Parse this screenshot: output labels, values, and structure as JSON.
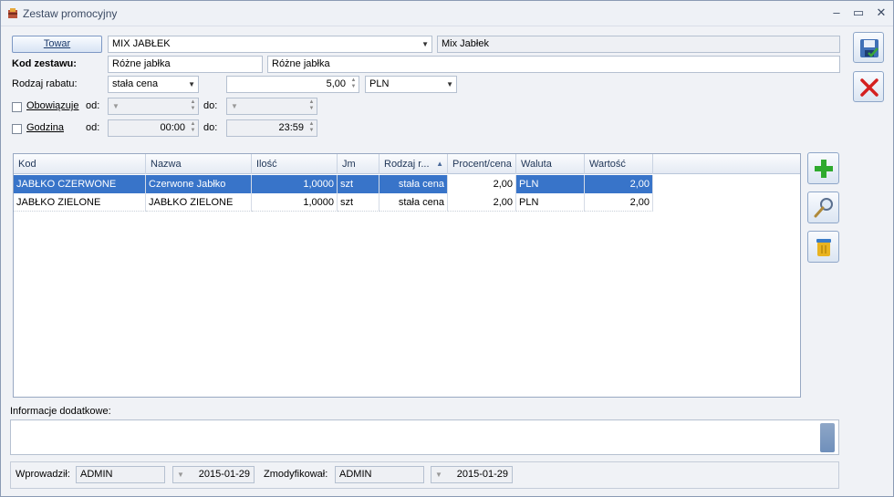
{
  "window": {
    "title": "Zestaw promocyjny",
    "minimize": "–",
    "restore": "▭",
    "close": "✕"
  },
  "form": {
    "towar_button": "Towar",
    "towar_value": "MIX JABŁEK",
    "towar_name": "Mix Jabłek",
    "kod_label": "Kod zestawu:",
    "kod_value": "Różne jabłka",
    "kod_name": "Różne jabłka",
    "rabat_label": "Rodzaj rabatu:",
    "rabat_type": "stała cena",
    "rabat_value": "5,00",
    "currency": "PLN",
    "obowiazuje_label": "Obowiązuje",
    "od_label": "od:",
    "do_label": "do:",
    "obow_od": "",
    "obow_do": "",
    "godzina_label": "Godzina",
    "godz_od": "00:00",
    "godz_do": "23:59"
  },
  "table": {
    "columns": [
      "Kod",
      "Nazwa",
      "Ilość",
      "Jm",
      "Rodzaj r...",
      "Procent/cena",
      "Waluta",
      "Wartość"
    ],
    "sort_indicator": "▲",
    "rows": [
      {
        "kod": "JABŁKO CZERWONE",
        "nazwa": "Czerwone Jabłko",
        "ilosc": "1,0000",
        "jm": "szt",
        "rodzaj": "stała cena",
        "procent": "2,00",
        "waluta": "PLN",
        "wartosc": "2,00",
        "selected": true
      },
      {
        "kod": "JABŁKO ZIELONE",
        "nazwa": "JABŁKO ZIELONE",
        "ilosc": "1,0000",
        "jm": "szt",
        "rodzaj": "stała cena",
        "procent": "2,00",
        "waluta": "PLN",
        "wartosc": "2,00",
        "selected": false
      }
    ]
  },
  "info": {
    "label": "Informacje dodatkowe:",
    "value": ""
  },
  "footer": {
    "wprowadzil_label": "Wprowadził:",
    "wprowadzil_user": "ADMIN",
    "wprowadzil_date": "2015-01-29",
    "zmodyfikowal_label": "Zmodyfikował:",
    "zmodyfikowal_user": "ADMIN",
    "zmodyfikowal_date": "2015-01-29"
  },
  "icons": {
    "save": "save-icon",
    "cancel": "cancel-icon",
    "add": "add-icon",
    "edit": "magnifier-icon",
    "delete": "trash-icon"
  },
  "colors": {
    "selection": "#3874c9",
    "accent": "#1c3a6b",
    "add_green": "#2eaa2e",
    "cancel_red": "#d42020"
  }
}
